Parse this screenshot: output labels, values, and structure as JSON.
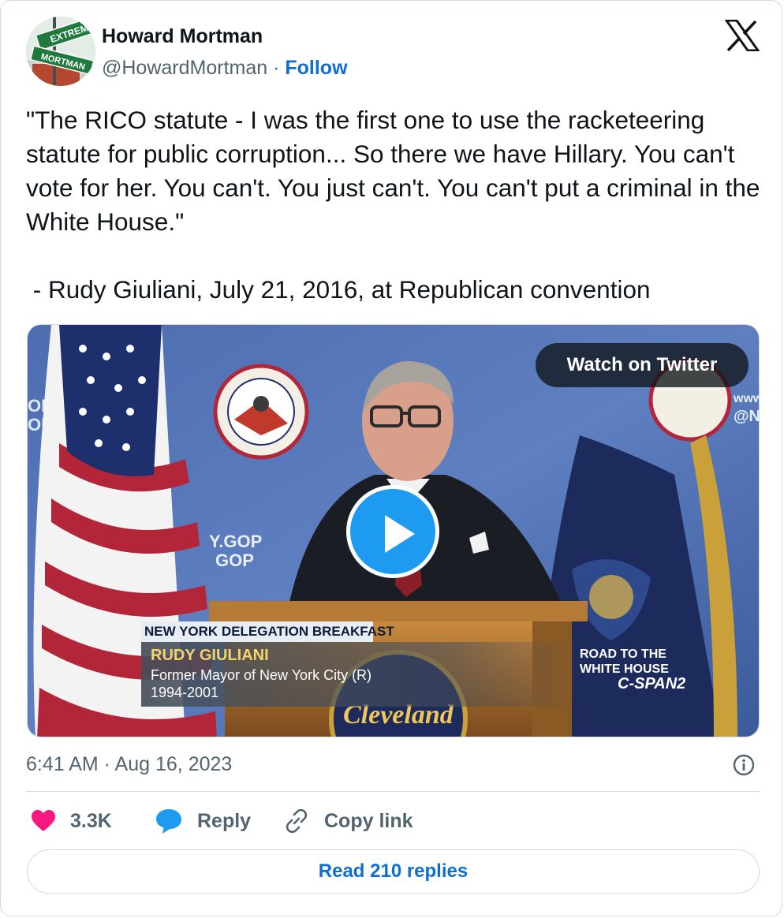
{
  "author": {
    "name": "Howard Mortman",
    "handle": "@HowardMortman",
    "separator": " · ",
    "follow_label": "Follow",
    "avatar_sign_top": "EXTREME",
    "avatar_sign_bottom": "MORTMAN"
  },
  "tweet": {
    "text": "\"The RICO statute - I was the first one to use the racketeering statute for public corruption... So there we have Hillary. You can't vote for her. You can't. You just can't. You can't put a criminal in the White House.\"\n\n - Rudy Giuliani, July 21, 2016, at Republican convention"
  },
  "media": {
    "watch_label": "Watch on Twitter",
    "lower_third": {
      "event": "NEW YORK DELEGATION BREAKFAST",
      "name": "RUDY GIULIANI",
      "title": "Former Mayor of New York City (R)",
      "years": "1994-2001"
    },
    "network": {
      "line1": "ROAD TO THE",
      "line2": "WHITE HOUSE",
      "line3": "C-SPAN2"
    },
    "backdrop_text_left_1": "OP",
    "backdrop_text_left_2": "OP",
    "backdrop_text_mid_1": "Y.GOP",
    "backdrop_text_mid_2": "GOP",
    "backdrop_text_right_1": "www.",
    "backdrop_text_right_2": "@N",
    "podium_script": "Cleveland"
  },
  "meta": {
    "timestamp": "6:41 AM · Aug 16, 2023"
  },
  "actions": {
    "like_count": "3.3K",
    "reply_label": "Reply",
    "copy_label": "Copy link",
    "read_replies_label": "Read 210 replies"
  },
  "colors": {
    "like": "#f91880",
    "reply": "#1d9bf0",
    "link": "#0f6fd1",
    "muted": "#536471"
  }
}
